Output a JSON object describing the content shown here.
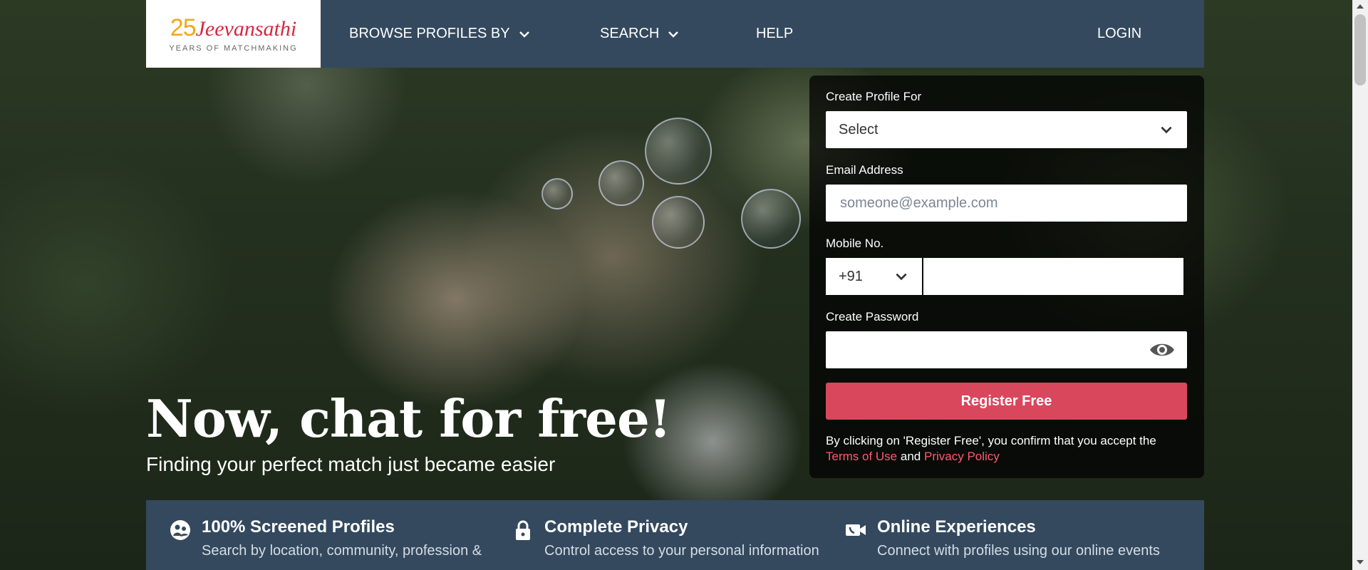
{
  "header": {
    "logo_number": "25",
    "logo_name": "Jeevansathi",
    "logo_tagline": "YEARS OF MATCHMAKING",
    "nav": {
      "browse": "BROWSE PROFILES BY",
      "search": "SEARCH",
      "help": "HELP",
      "login": "LOGIN"
    }
  },
  "hero": {
    "title": "Now, chat for free!",
    "subtitle": "Finding your perfect match just became easier"
  },
  "form": {
    "profile_for_label": "Create Profile For",
    "profile_for_value": "Select",
    "email_label": "Email Address",
    "email_placeholder": "someone@example.com",
    "mobile_label": "Mobile No.",
    "country_code": "+91",
    "password_label": "Create Password",
    "register_button": "Register Free",
    "consent_text": "By clicking on 'Register Free', you confirm that you accept the",
    "terms_link": "Terms of Use",
    "and_text": "and",
    "privacy_link": "Privacy Policy"
  },
  "features": [
    {
      "icon": "screened-profiles-icon",
      "title": "100% Screened Profiles",
      "desc": "Search by location, community, profession &"
    },
    {
      "icon": "lock-icon",
      "title": "Complete Privacy",
      "desc": "Control access to your personal information"
    },
    {
      "icon": "video-call-icon",
      "title": "Online Experiences",
      "desc": "Connect with profiles using our online events"
    }
  ],
  "colors": {
    "header_bg": "#34495e",
    "brand_red": "#d7263d",
    "brand_yellow": "#f0a91b",
    "button": "#d9475d",
    "link": "#ff5a6e"
  }
}
